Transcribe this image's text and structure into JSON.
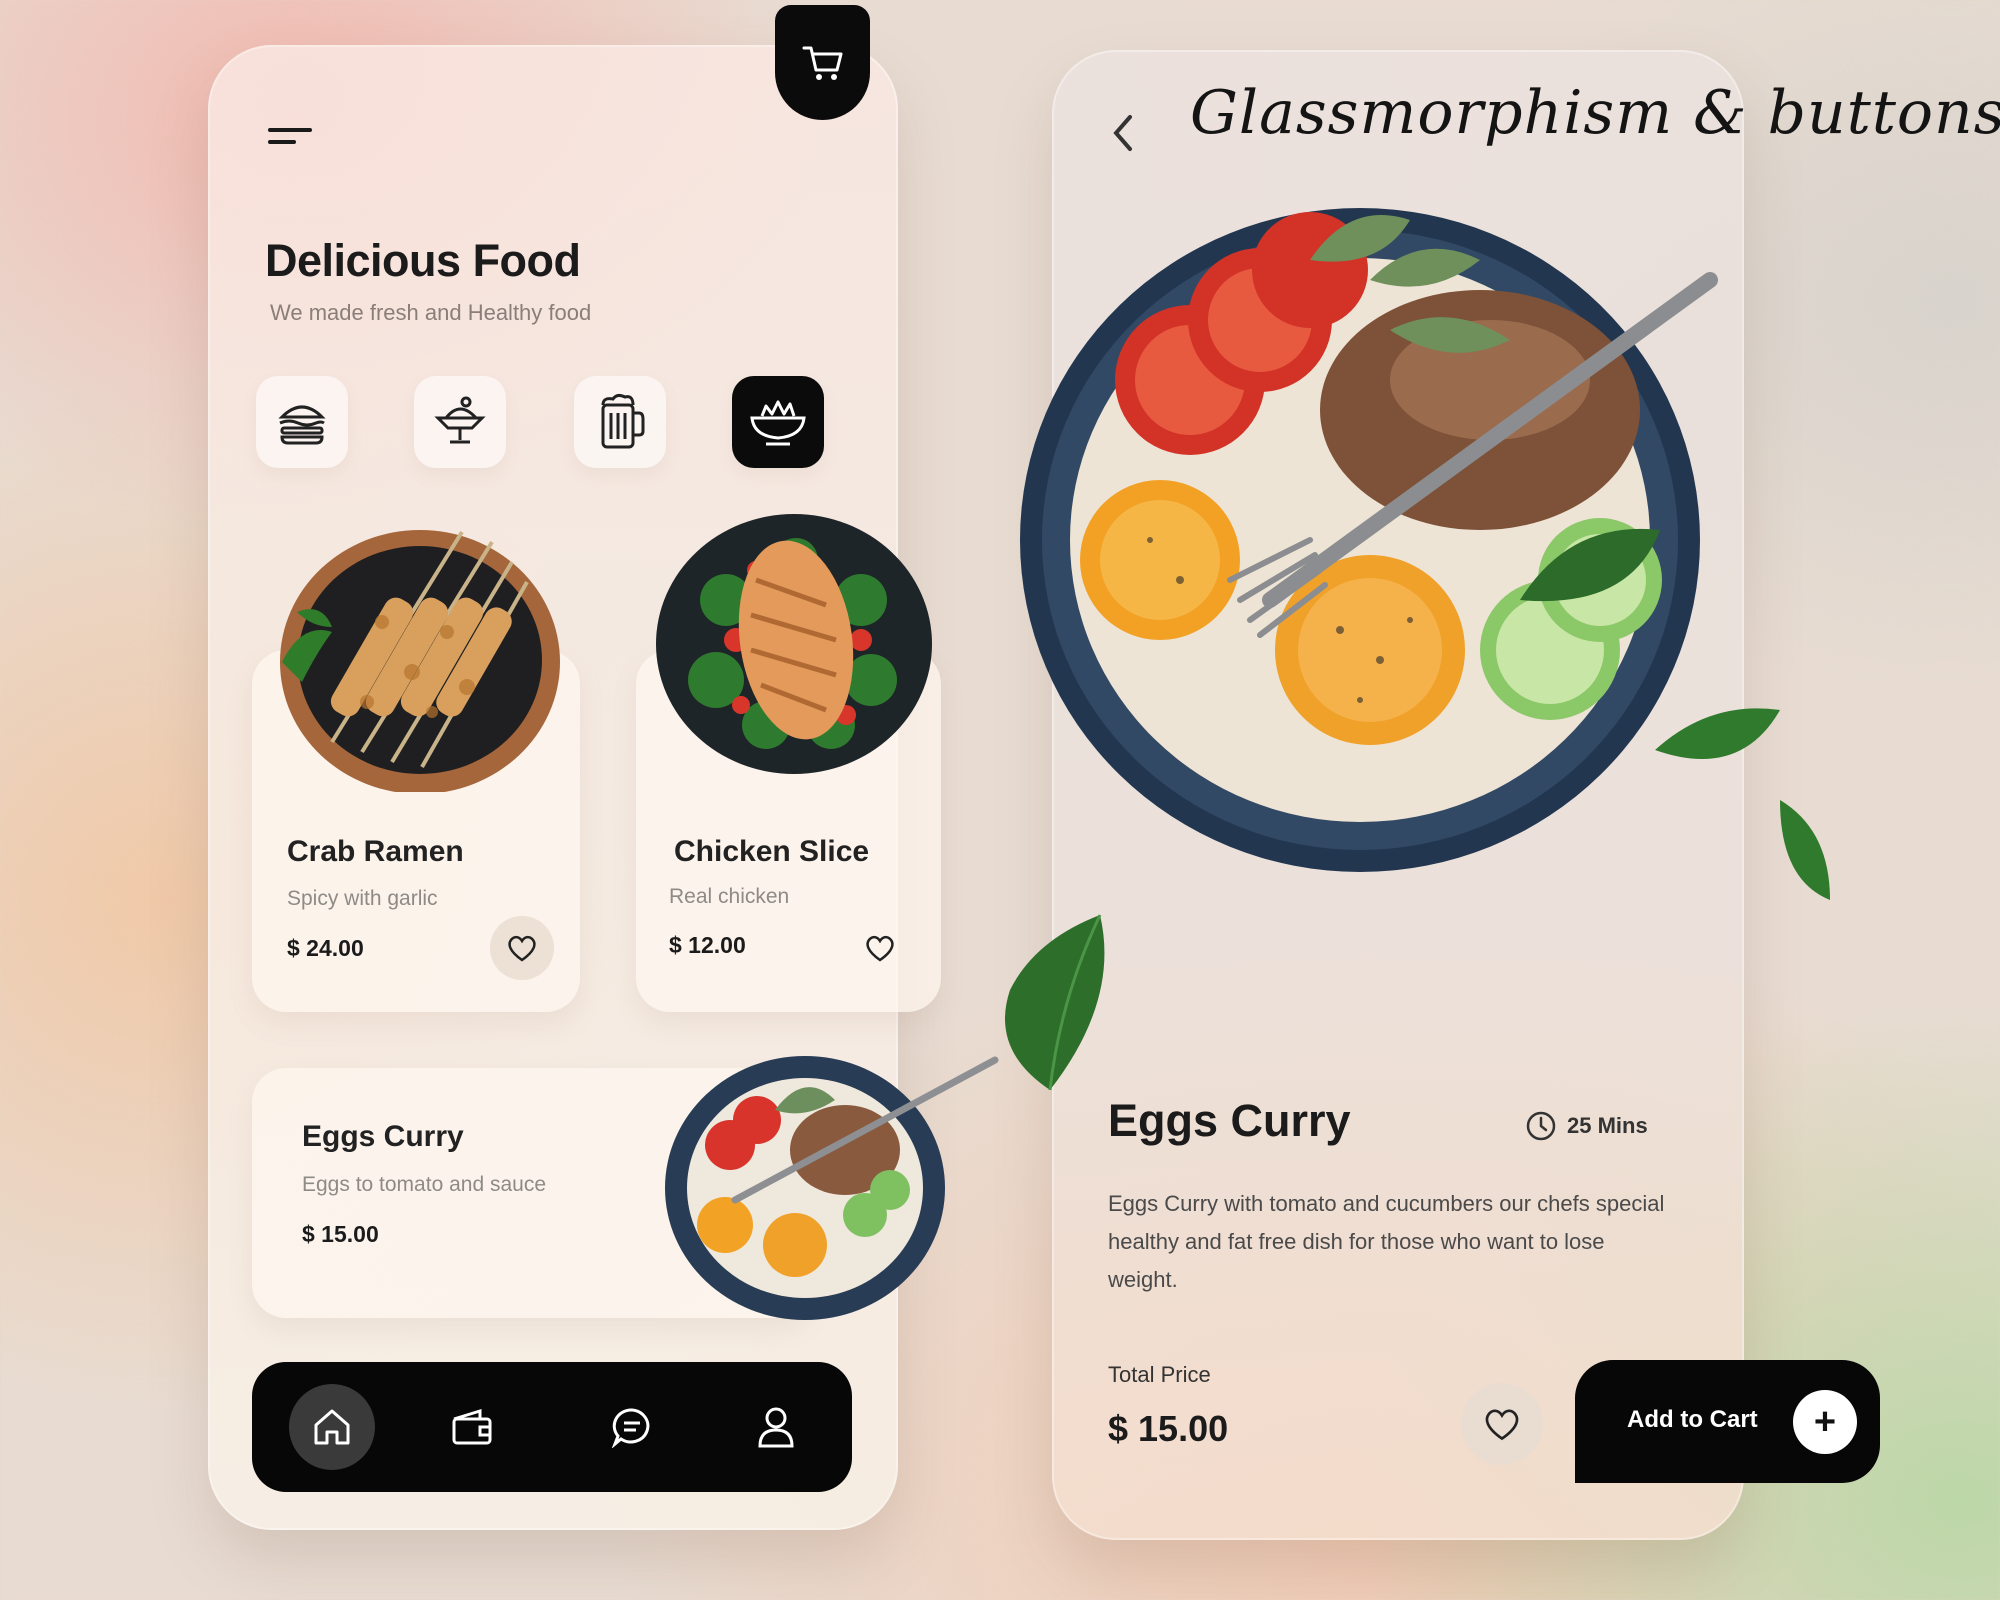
{
  "header": {
    "script_title": "Glassmorphism & buttons"
  },
  "left_screen": {
    "title": "Delicious Food",
    "subtitle": "We made fresh and Healthy food",
    "categories": [
      {
        "icon": "burger-icon",
        "active": false
      },
      {
        "icon": "dessert-icon",
        "active": false
      },
      {
        "icon": "beer-mug-icon",
        "active": false
      },
      {
        "icon": "salad-bowl-icon",
        "active": true
      }
    ],
    "cards": [
      {
        "name": "Crab Ramen",
        "desc": "Spicy with garlic",
        "price": "$ 24.00"
      },
      {
        "name": "Chicken Slice",
        "desc": "Real chicken",
        "price": "$ 12.00"
      }
    ],
    "wide_card": {
      "name": "Eggs Curry",
      "desc": "Eggs to tomato and sauce",
      "price": "$ 15.00"
    },
    "bottom_nav": [
      {
        "icon": "home-icon",
        "active": true
      },
      {
        "icon": "wallet-icon",
        "active": false
      },
      {
        "icon": "chat-icon",
        "active": false
      },
      {
        "icon": "user-icon",
        "active": false
      }
    ]
  },
  "right_screen": {
    "name": "Eggs Curry",
    "time": "25 Mins",
    "description": "Eggs Curry with tomato and cucumbers our chefs special healthy and fat free dish for those who want to lose weight.",
    "total_label": "Total Price",
    "total_price": "$ 15.00",
    "add_to_cart": "Add to Cart",
    "plus": "+"
  },
  "colors": {
    "accent_dark": "#0b0b0b",
    "card_bg": "#fff7f0"
  }
}
